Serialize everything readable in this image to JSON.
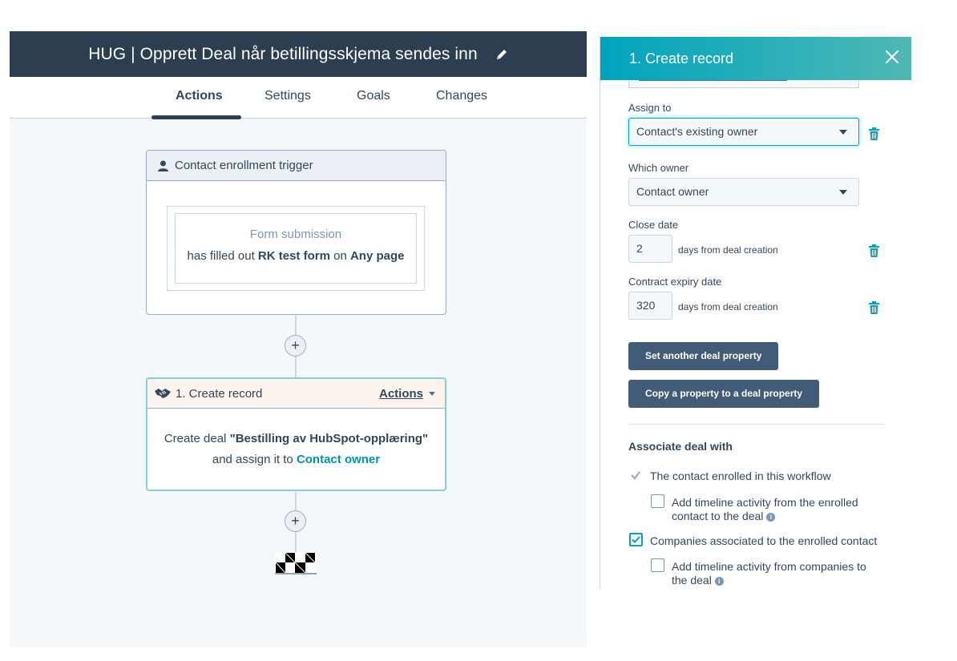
{
  "workflow": {
    "title": "HUG | Opprett Deal når betillingsskjema sendes inn",
    "tabs": [
      {
        "label": "Actions",
        "active": true
      },
      {
        "label": "Settings"
      },
      {
        "label": "Goals"
      },
      {
        "label": "Changes"
      }
    ],
    "trigger": {
      "header": "Contact enrollment trigger",
      "form_label": "Form submission",
      "filter_prefix": "has filled out",
      "form_name": "RK test form",
      "filter_mid": "on",
      "page": "Any page"
    },
    "action": {
      "header": "1. Create record",
      "actions_label": "Actions",
      "body_prefix": "Create deal",
      "deal_name": "\"Bestilling av HubSpot-opplæring\"",
      "body_mid": "and assign it to",
      "owner": "Contact owner"
    },
    "add_symbol": "+"
  },
  "panel": {
    "title": "1. Create record",
    "close_symbol": "✕",
    "assign_to_label": "Assign to",
    "assign_to_value": "Contact's existing owner",
    "which_owner_label": "Which owner",
    "which_owner_value": "Contact owner",
    "close_date_label": "Close date",
    "close_date_value": "2",
    "close_date_suffix": "days from deal creation",
    "contract_label": "Contract expiry date",
    "contract_value": "320",
    "contract_suffix": "days from deal creation",
    "btn_set_property": "Set another deal property",
    "btn_copy_property": "Copy a property to a deal property",
    "associate_title": "Associate deal with",
    "assoc_contact": "The contact enrolled in this workflow",
    "assoc_contact_timeline": "Add timeline activity from the enrolled contact to the deal",
    "assoc_companies": "Companies associated to the enrolled contact",
    "assoc_companies_timeline": "Add timeline activity from companies to the deal",
    "info_symbol": "i"
  },
  "colors": {
    "header_dark": "#2d3e50",
    "accent_teal": "#00a4bd",
    "button": "#425b76"
  }
}
